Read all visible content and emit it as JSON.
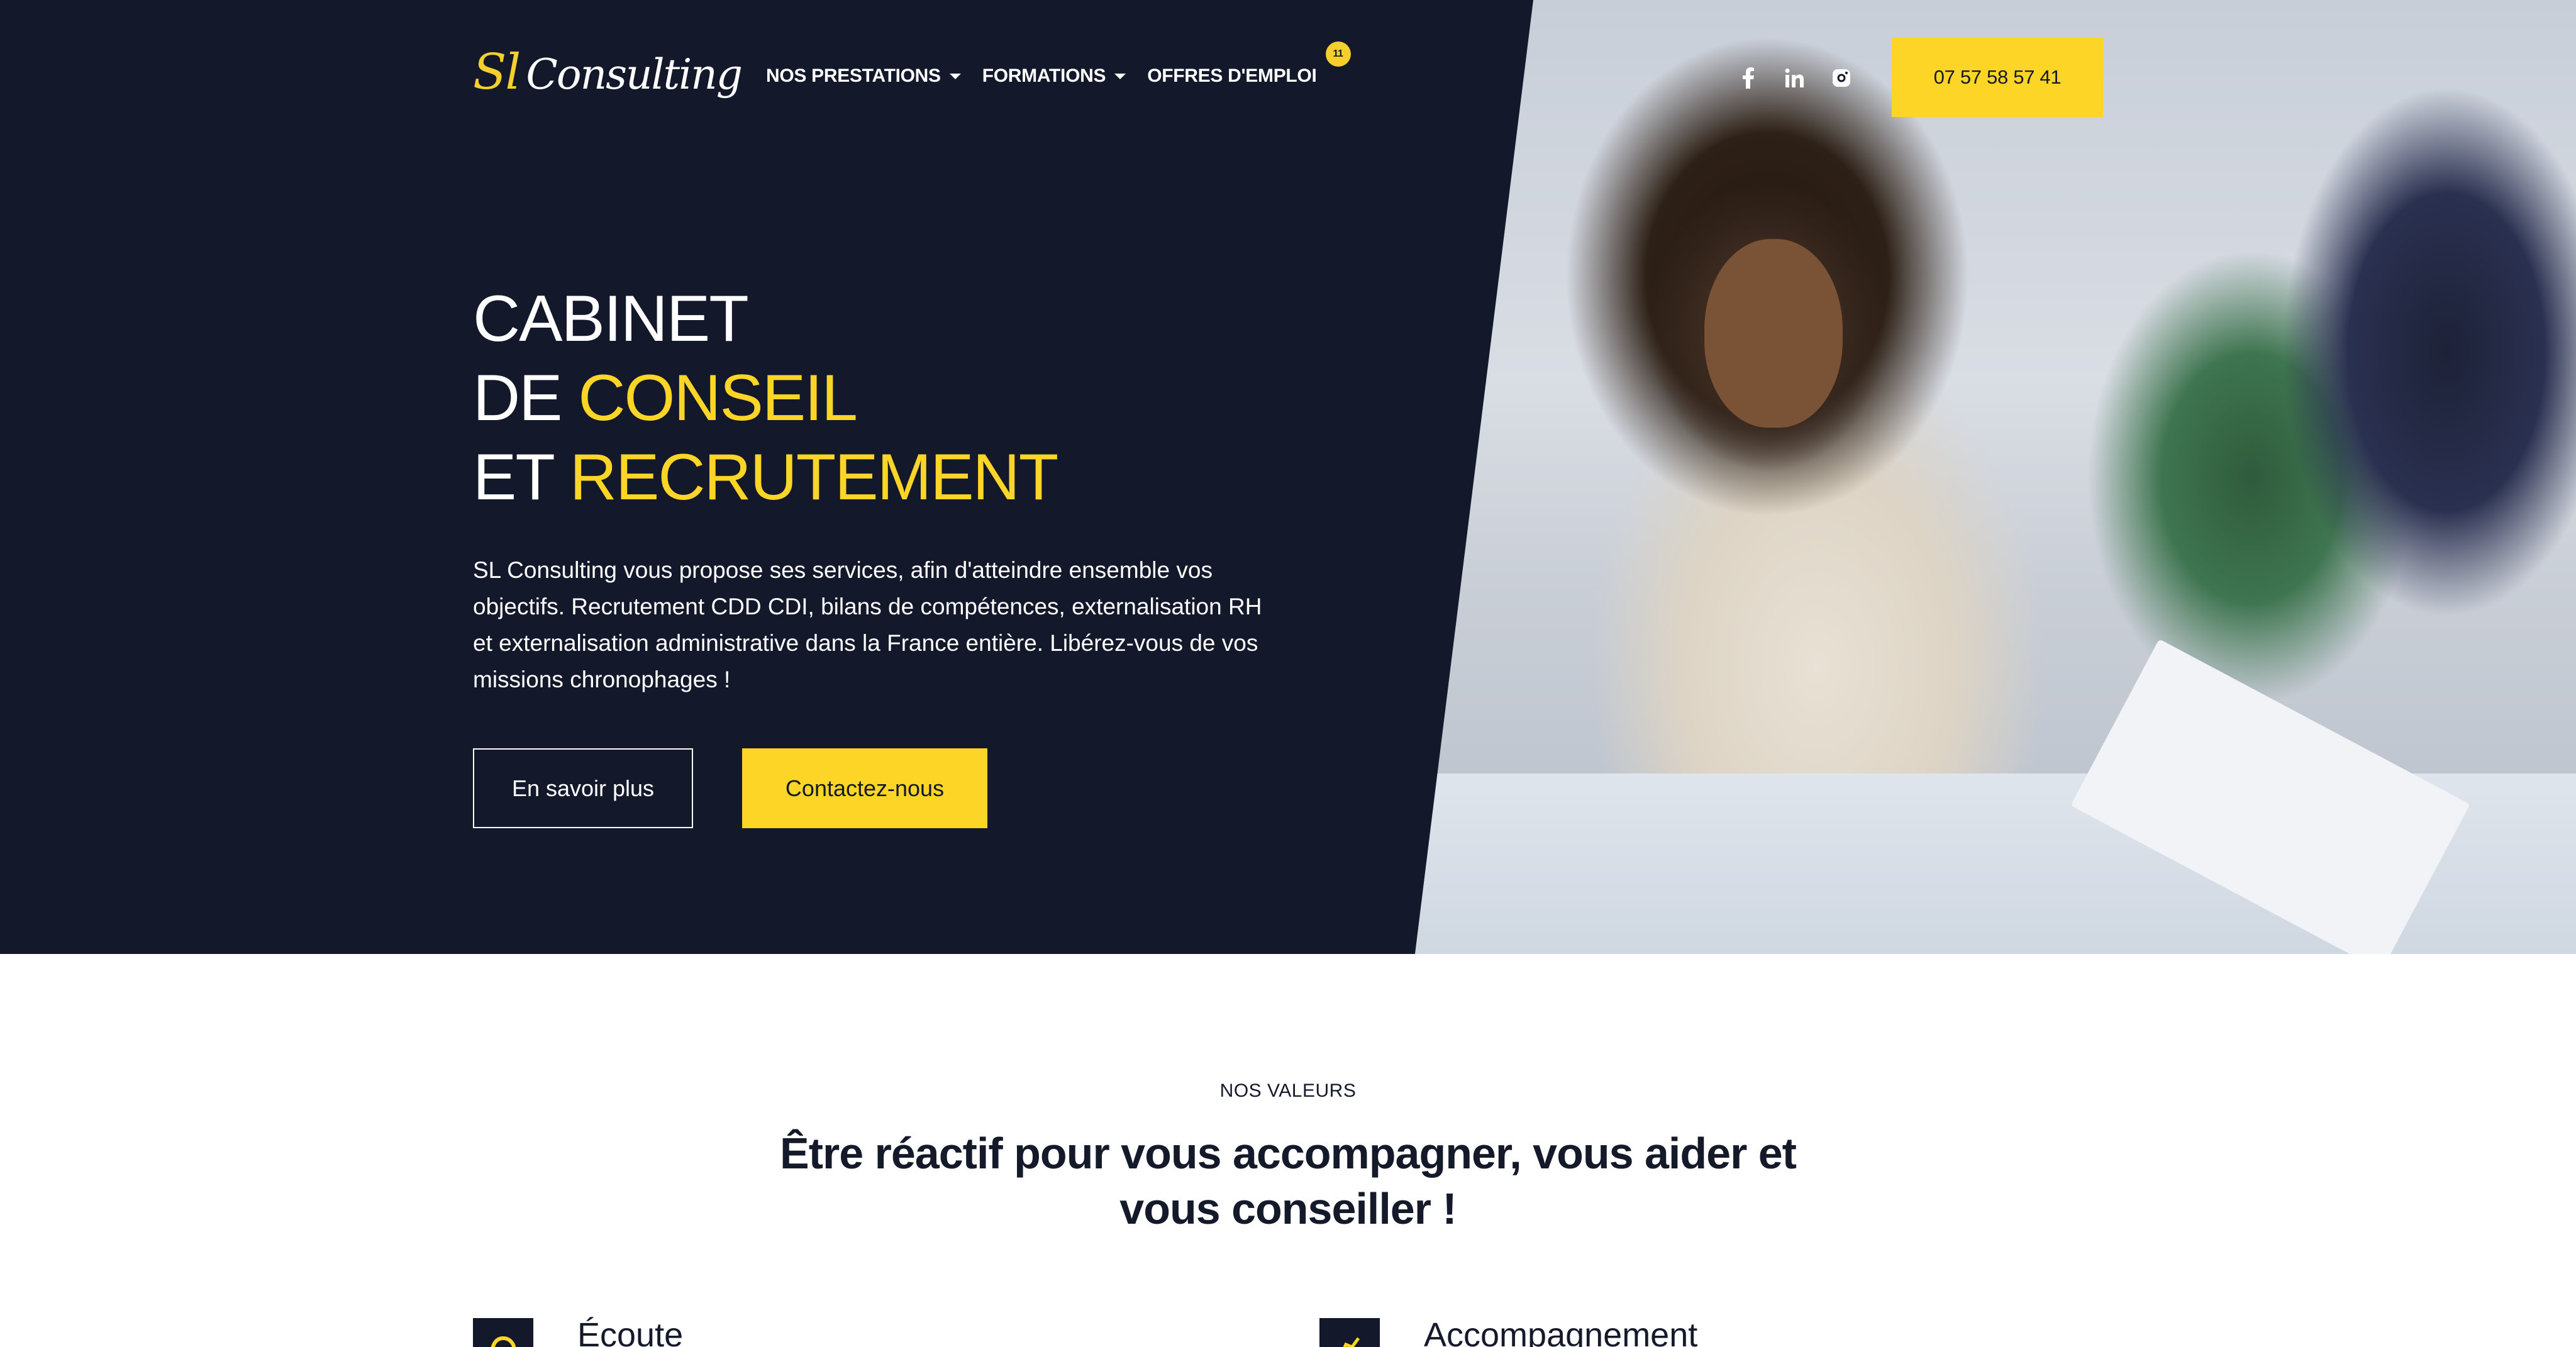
{
  "header": {
    "logo_sl": "Sl",
    "logo_consulting": "Consulting",
    "nav": [
      {
        "label": "NOS PRESTATIONS",
        "has_dropdown": true
      },
      {
        "label": "FORMATIONS",
        "has_dropdown": true
      },
      {
        "label": "OFFRES D'EMPLOI",
        "badge": "11"
      }
    ],
    "socials": [
      "facebook-icon",
      "linkedin-icon",
      "instagram-icon"
    ],
    "phone": "07 57 58 57 41"
  },
  "hero": {
    "line1": "CABINET",
    "line2_white": "DE ",
    "line2_yellow": "CONSEIL",
    "line3_white": "ET ",
    "line3_yellow": "RECRUTEMENT",
    "description": "SL Consulting vous propose ses services, afin d'atteindre ensemble vos objectifs. Recrutement CDD CDI, bilans de compétences, externalisation RH et externalisation administrative dans la France entière. Libérez-vous de vos missions chronophages !",
    "btn_more": "En savoir plus",
    "btn_contact": "Contactez-nous"
  },
  "values": {
    "eyebrow": "NOS VALEURS",
    "title": "Être réactif pour vous accompagner, vous aider et vous conseiller !",
    "items": [
      {
        "label": "Écoute",
        "icon": "ear-icon"
      },
      {
        "label": "Accompagnement",
        "icon": "handshake-icon"
      }
    ]
  },
  "colors": {
    "navy": "#13182a",
    "yellow": "#fdd526",
    "white": "#ffffff"
  }
}
